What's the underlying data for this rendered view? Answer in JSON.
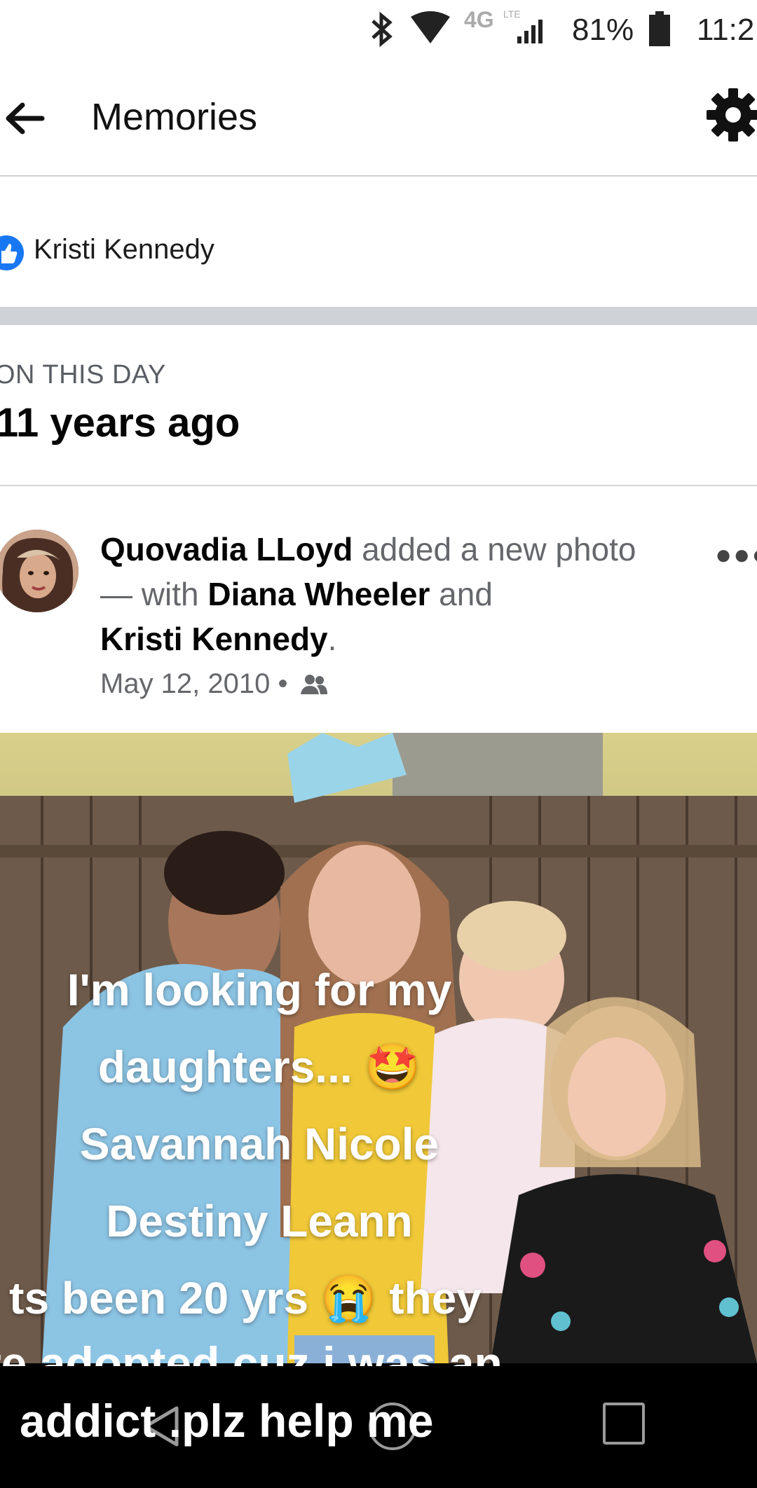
{
  "status_bar": {
    "bluetooth_icon": "bluetooth-icon",
    "wifi_icon": "wifi-icon",
    "network": "4G",
    "network_sub": "LTE",
    "battery": "81%",
    "time": "11:2"
  },
  "header": {
    "title": "Memories",
    "back_icon": "arrow-left-icon",
    "settings_icon": "gear-icon"
  },
  "like_row": {
    "name": "Kristi Kennedy"
  },
  "memory": {
    "on_this_day": "ON THIS DAY",
    "years_ago": "11 years ago"
  },
  "post": {
    "author": "Quovadia LLoyd",
    "action1": "added a new photo — with",
    "tag1": "Diana Wheeler",
    "conj": "and",
    "tag2": "Kristi Kennedy",
    "period": ".",
    "date": "May 12, 2010 •",
    "audience_icon": "friends-icon",
    "more_icon": "more-dots-icon"
  },
  "photo_overlay": {
    "line1": "I'm looking for my",
    "line2": "daughters... 🤩",
    "line3": "Savannah Nicole",
    "line4": "Destiny Leann",
    "line5": "ts been 20 yrs 😭 they",
    "line6": "re adopted cuz i was an",
    "line7": "addict  .plz help me"
  },
  "colors": {
    "accent": "#1877f2",
    "divider": "#cfd2d6",
    "secondary_text": "#65676b"
  }
}
